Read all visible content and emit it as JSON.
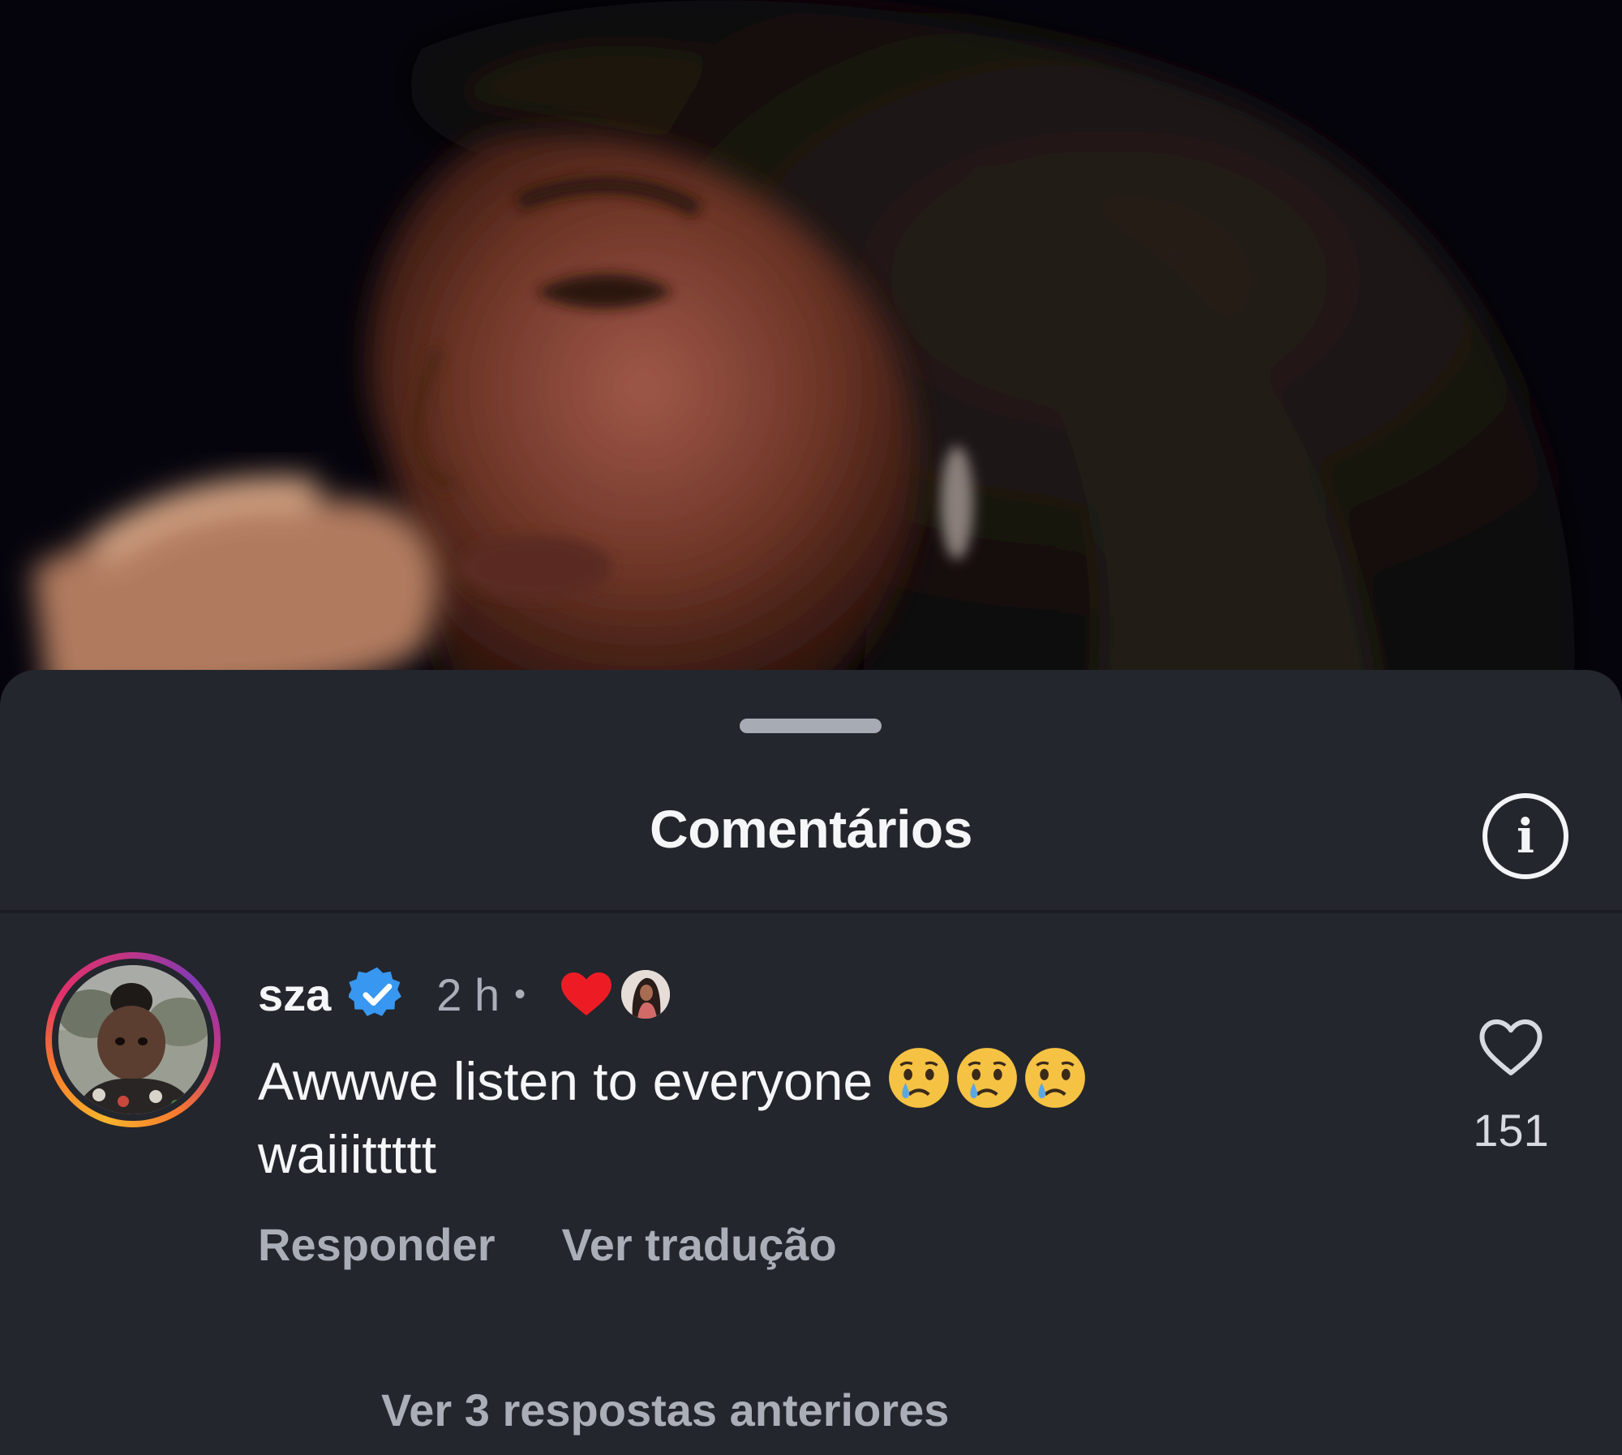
{
  "sheet": {
    "title": "Comentários",
    "info_icon": "info-icon",
    "info_glyph": "i"
  },
  "comment": {
    "username": "sza",
    "verified_icon": "verified-badge-icon",
    "time": "2 h",
    "separator": "•",
    "creator_liked_icon": "heart-filled-icon",
    "text": "Awwwe listen to everyone",
    "emojis": [
      "crying-face",
      "crying-face",
      "crying-face"
    ],
    "text_continued": "waiiittttt",
    "like_icon": "heart-outline-icon",
    "like_count": "151",
    "reply_label": "Responder",
    "translate_label": "Ver tradução",
    "view_replies_label": "Ver 3 respostas anteriores"
  },
  "colors": {
    "sheet_background": "#23262c",
    "primary_text": "#f5f6f8",
    "secondary_text": "#a9aeb7",
    "verified_blue": "#3897f0",
    "heart_red": "#ed1c24"
  }
}
